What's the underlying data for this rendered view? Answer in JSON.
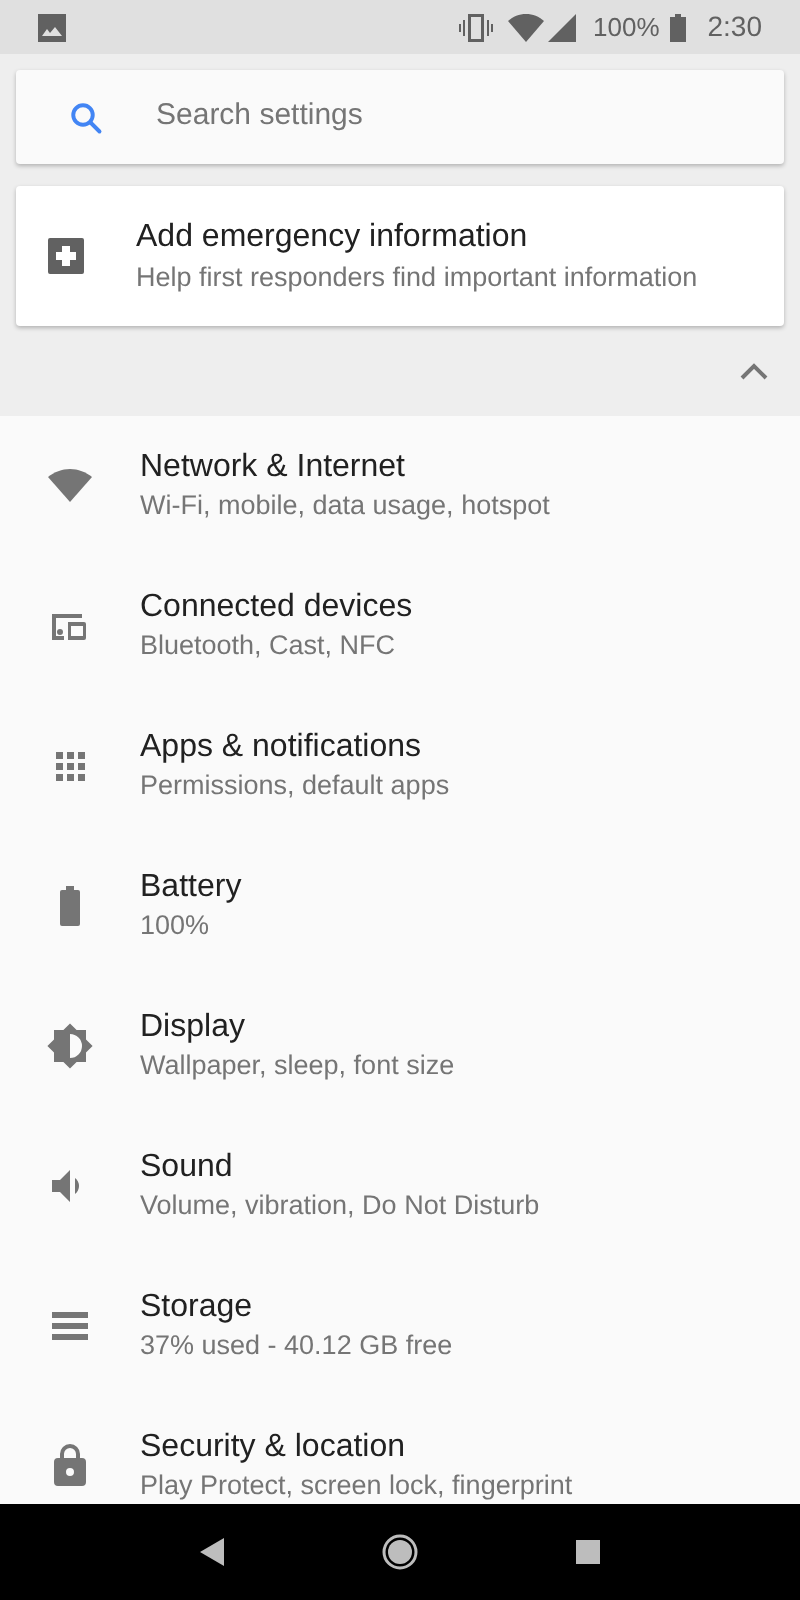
{
  "status_bar": {
    "battery_text": "100%",
    "time": "2:30"
  },
  "search": {
    "placeholder": "Search settings"
  },
  "suggestion": {
    "title": "Add emergency information",
    "subtitle": "Help first responders find important information"
  },
  "suggestions_expanded": true,
  "items": [
    {
      "kind": "network",
      "title": "Network & Internet",
      "subtitle": "Wi-Fi, mobile, data usage, hotspot"
    },
    {
      "kind": "devices",
      "title": "Connected devices",
      "subtitle": "Bluetooth, Cast, NFC"
    },
    {
      "kind": "apps",
      "title": "Apps & notifications",
      "subtitle": "Permissions, default apps"
    },
    {
      "kind": "battery",
      "title": "Battery",
      "subtitle": "100%"
    },
    {
      "kind": "display",
      "title": "Display",
      "subtitle": "Wallpaper, sleep, font size"
    },
    {
      "kind": "sound",
      "title": "Sound",
      "subtitle": "Volume, vibration, Do Not Disturb"
    },
    {
      "kind": "storage",
      "title": "Storage",
      "subtitle": "37% used - 40.12 GB free"
    },
    {
      "kind": "security",
      "title": "Security & location",
      "subtitle": "Play Protect, screen lock, fingerprint"
    }
  ]
}
